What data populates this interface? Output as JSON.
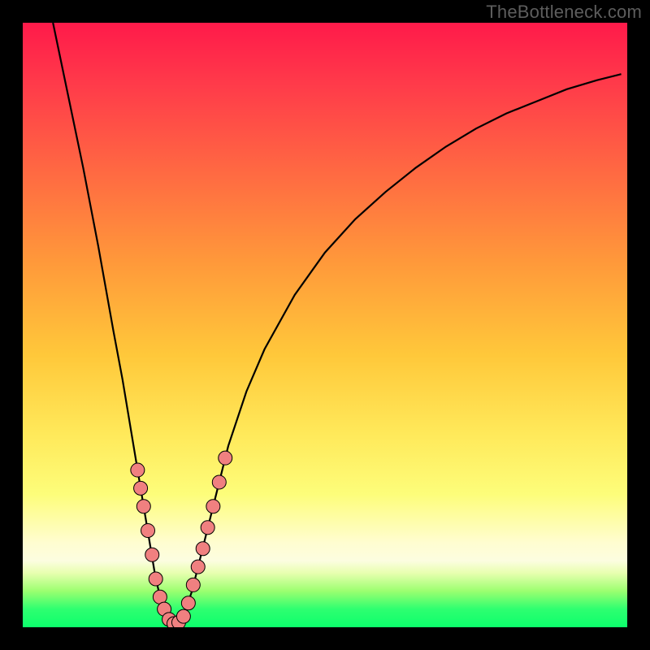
{
  "watermark": "TheBottleneck.com",
  "colors": {
    "curve_stroke": "#000000",
    "marker_fill": "#f08080",
    "marker_stroke": "#000000",
    "frame": "#000000"
  },
  "chart_data": {
    "type": "line",
    "title": "",
    "xlabel": "",
    "ylabel": "",
    "xlim": [
      0,
      100
    ],
    "ylim": [
      0,
      100
    ],
    "curve": [
      {
        "x": 5.0,
        "y": 100.0
      },
      {
        "x": 7.5,
        "y": 88.0
      },
      {
        "x": 10.0,
        "y": 76.0
      },
      {
        "x": 12.5,
        "y": 63.0
      },
      {
        "x": 15.0,
        "y": 49.0
      },
      {
        "x": 16.5,
        "y": 41.0
      },
      {
        "x": 18.0,
        "y": 32.0
      },
      {
        "x": 19.0,
        "y": 26.0
      },
      {
        "x": 20.0,
        "y": 20.0
      },
      {
        "x": 21.0,
        "y": 14.0
      },
      {
        "x": 22.0,
        "y": 8.0
      },
      {
        "x": 23.0,
        "y": 4.0
      },
      {
        "x": 24.0,
        "y": 1.5
      },
      {
        "x": 25.0,
        "y": 0.5
      },
      {
        "x": 26.0,
        "y": 1.0
      },
      {
        "x": 27.0,
        "y": 3.0
      },
      {
        "x": 28.0,
        "y": 6.0
      },
      {
        "x": 29.0,
        "y": 10.0
      },
      {
        "x": 30.0,
        "y": 14.0
      },
      {
        "x": 32.0,
        "y": 22.0
      },
      {
        "x": 34.0,
        "y": 30.0
      },
      {
        "x": 37.0,
        "y": 39.0
      },
      {
        "x": 40.0,
        "y": 46.0
      },
      {
        "x": 45.0,
        "y": 55.0
      },
      {
        "x": 50.0,
        "y": 62.0
      },
      {
        "x": 55.0,
        "y": 67.5
      },
      {
        "x": 60.0,
        "y": 72.0
      },
      {
        "x": 65.0,
        "y": 76.0
      },
      {
        "x": 70.0,
        "y": 79.5
      },
      {
        "x": 75.0,
        "y": 82.5
      },
      {
        "x": 80.0,
        "y": 85.0
      },
      {
        "x": 85.0,
        "y": 87.0
      },
      {
        "x": 90.0,
        "y": 89.0
      },
      {
        "x": 95.0,
        "y": 90.5
      },
      {
        "x": 99.0,
        "y": 91.5
      }
    ],
    "markers_left": [
      {
        "x": 19.0,
        "y": 26.0
      },
      {
        "x": 19.5,
        "y": 23.0
      },
      {
        "x": 20.0,
        "y": 20.0
      },
      {
        "x": 20.7,
        "y": 16.0
      },
      {
        "x": 21.4,
        "y": 12.0
      },
      {
        "x": 22.0,
        "y": 8.0
      },
      {
        "x": 22.7,
        "y": 5.0
      },
      {
        "x": 23.4,
        "y": 3.0
      },
      {
        "x": 24.2,
        "y": 1.3
      },
      {
        "x": 25.0,
        "y": 0.6
      },
      {
        "x": 25.8,
        "y": 0.8
      }
    ],
    "markers_right": [
      {
        "x": 26.6,
        "y": 1.8
      },
      {
        "x": 27.4,
        "y": 4.0
      },
      {
        "x": 28.2,
        "y": 7.0
      },
      {
        "x": 29.0,
        "y": 10.0
      },
      {
        "x": 29.8,
        "y": 13.0
      },
      {
        "x": 30.6,
        "y": 16.5
      },
      {
        "x": 31.5,
        "y": 20.0
      },
      {
        "x": 32.5,
        "y": 24.0
      },
      {
        "x": 33.5,
        "y": 28.0
      }
    ]
  }
}
